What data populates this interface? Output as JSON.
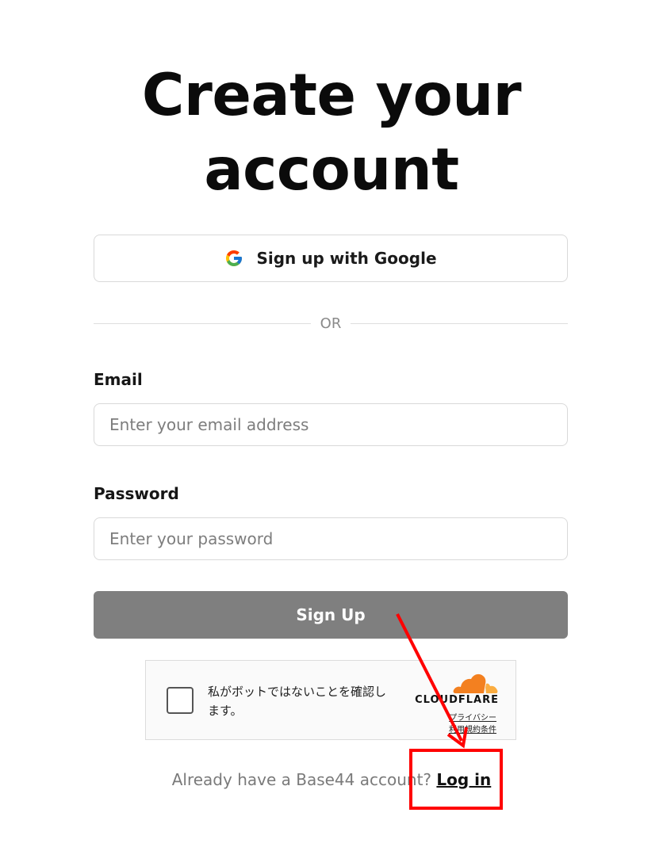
{
  "page": {
    "title_line1": "Create your",
    "title_line2": "account"
  },
  "google_button": {
    "icon": "google-g-icon",
    "label": "Sign up with Google"
  },
  "divider": {
    "text": "OR"
  },
  "email": {
    "label": "Email",
    "placeholder": "Enter your email address",
    "value": ""
  },
  "password": {
    "label": "Password",
    "placeholder": "Enter your password",
    "value": ""
  },
  "signup_button": {
    "label": "Sign Up"
  },
  "captcha": {
    "checkbox_text": "私がボットではないことを確認します。",
    "brand": "CLOUDFLARE",
    "privacy_link": "プライバシー",
    "terms_link": "利用規約条件"
  },
  "footer": {
    "prompt": "Already have a Base44 account?",
    "login_link": "Log in"
  },
  "colors": {
    "signup_button_bg": "#7f7f7f",
    "annotation_red": "#ff0000",
    "cloudflare_orange": "#f38020"
  }
}
